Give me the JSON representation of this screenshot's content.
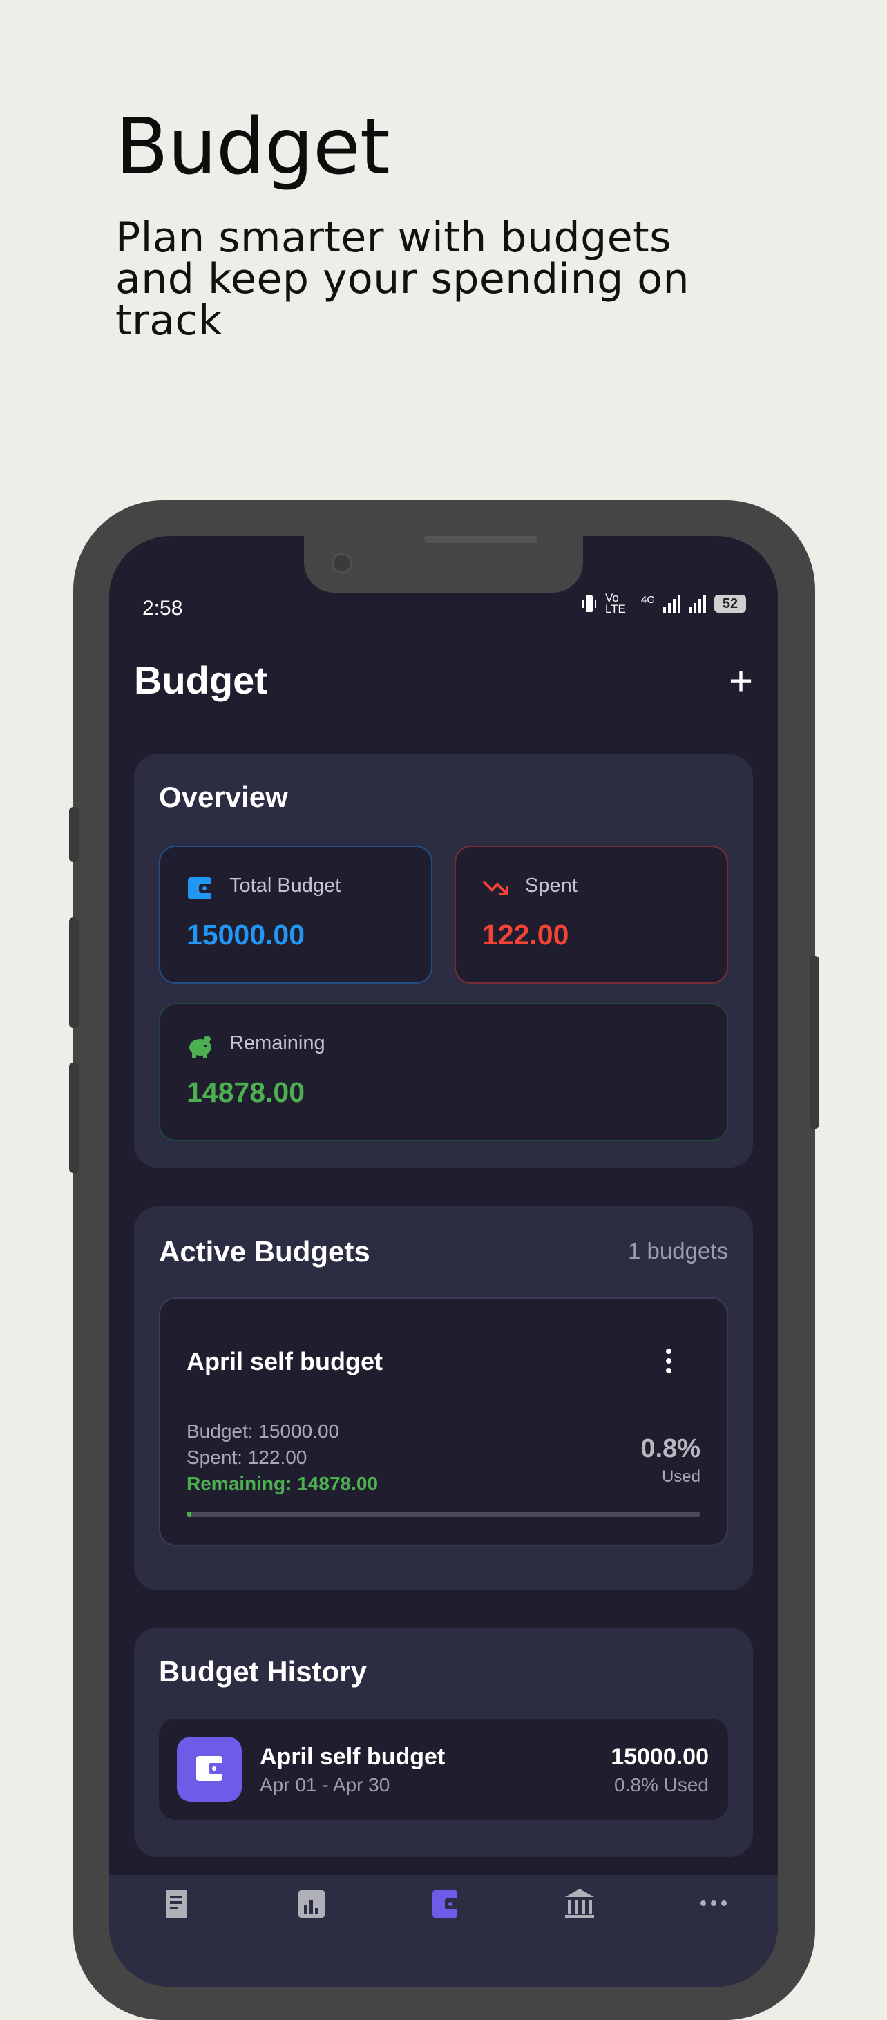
{
  "promo": {
    "title": "Budget",
    "subtitle": "Plan smarter with budgets and keep your spending on track"
  },
  "status_bar": {
    "time": "2:58",
    "network_label": "Vo LTE",
    "network_type": "4G",
    "battery": "52"
  },
  "header": {
    "title": "Budget",
    "add_label": "+"
  },
  "overview": {
    "title": "Overview",
    "total_budget": {
      "label": "Total Budget",
      "value": "15000.00",
      "color": "#2196f3",
      "icon": "wallet-icon"
    },
    "spent": {
      "label": "Spent",
      "value": "122.00",
      "color": "#f44336",
      "icon": "trending-down-icon"
    },
    "remaining": {
      "label": "Remaining",
      "value": "14878.00",
      "color": "#4caf50",
      "icon": "piggy-bank-icon"
    }
  },
  "active_budgets": {
    "title": "Active Budgets",
    "count": "1 budgets",
    "items": [
      {
        "name": "April self budget",
        "budget_line": "Budget: 15000.00",
        "spent_line": "Spent: 122.00",
        "remaining_line": "Remaining: 14878.00",
        "percent": "0.8%",
        "used_label": "Used",
        "progress_fraction": 0.008
      }
    ]
  },
  "history": {
    "title": "Budget History",
    "items": [
      {
        "name": "April self budget",
        "date_range": "Apr 01 - Apr 30",
        "amount": "15000.00",
        "used": "0.8% Used",
        "icon": "wallet-icon"
      }
    ]
  },
  "bottom_nav": {
    "items": [
      {
        "icon": "receipt-icon",
        "active": false
      },
      {
        "icon": "chart-icon",
        "active": false
      },
      {
        "icon": "wallet-icon",
        "active": true
      },
      {
        "icon": "bank-icon",
        "active": false
      },
      {
        "icon": "more-icon",
        "active": false
      }
    ],
    "active_color": "#6c5ce7"
  }
}
